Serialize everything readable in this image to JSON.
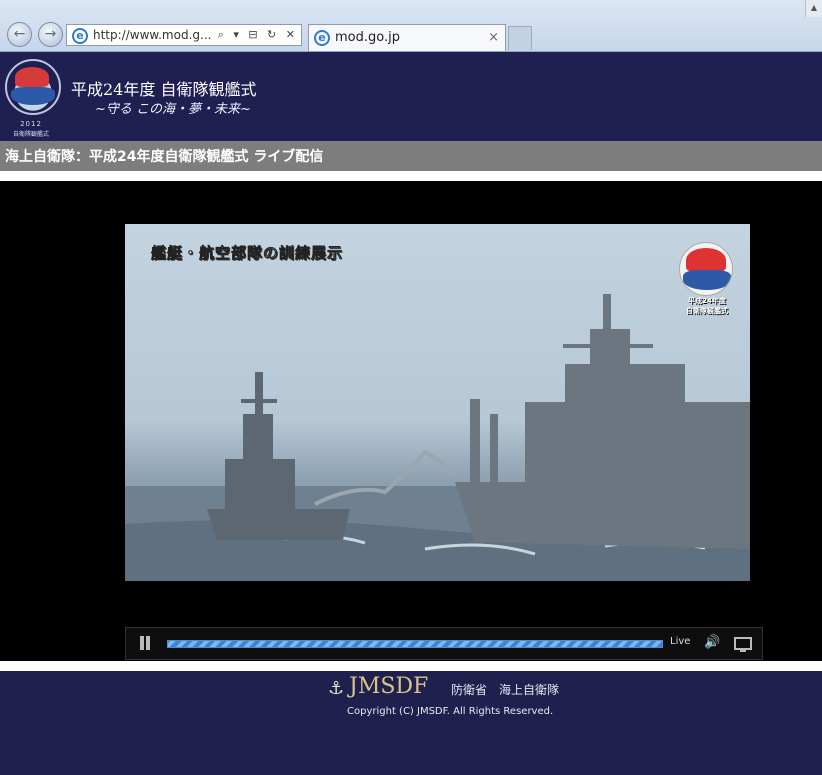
{
  "browser": {
    "address_url": "http://www.mod.g...",
    "address_tools": "⌕ ▾ ⊟ ↻ ✕",
    "tab_title": "mod.go.jp",
    "tab_close": "×",
    "back_icon": "←",
    "forward_icon": "→"
  },
  "header": {
    "event_title": "平成24年度 自衛隊観艦式",
    "event_subtitle": "~守る この海・夢・未来~",
    "logo_year": "2012",
    "logo_subtitle": "自衛隊観艦式"
  },
  "page": {
    "title": "海上自衛隊：平成24年度自衛隊観艦式 ライブ配信"
  },
  "video": {
    "caption": "艦艇・航空部隊の訓練展示",
    "channel_label_line1": "平成24年度",
    "channel_label_line2": "自衛隊観艦式"
  },
  "player": {
    "live_label": "Live",
    "progress": 1.0
  },
  "footer": {
    "brand": "JMSDF",
    "org": "防衛省　海上自衛隊",
    "copyright": "Copyright (C) JMSDF. All Rights Reserved."
  },
  "colors": {
    "header_bg": "#1f1f52",
    "title_bar_bg": "#7d7d7d",
    "progress_blue": "#3a84d6",
    "brand_gold": "#d9c38a"
  }
}
